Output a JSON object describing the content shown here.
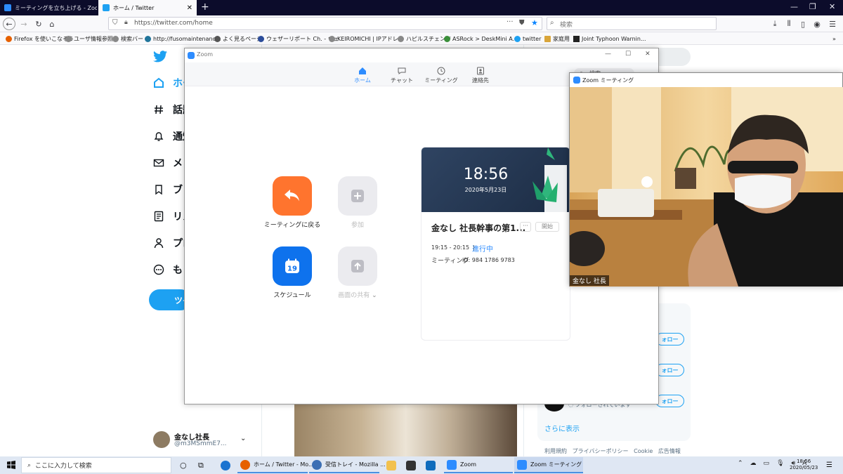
{
  "browser": {
    "tabs": [
      {
        "title": "ミーティングを立ち上げる - Zoom",
        "active": false
      },
      {
        "title": "ホーム / Twitter",
        "active": true
      }
    ],
    "url": "https://twitter.com/home",
    "search_placeholder": "検索",
    "bookmarks": [
      "Firefox を使いこなそう",
      "ユーザ情報参照",
      "検索バー",
      "http://fusomaintenanc...",
      "よく見るページ",
      "ウェザーリポート Ch. - ウェ...",
      "KEIROMICHI | IPアドレ...",
      "ハピルスチェンジ",
      "ASRock > DeskMini A...",
      "twitter",
      "家庭用",
      "Joint Typhoon Warnin..."
    ]
  },
  "twitter": {
    "nav": [
      "ホー",
      "話題",
      "通知",
      "メッ",
      "ブッ",
      "リス",
      "プロ",
      "もっ"
    ],
    "tweet_button": "ツイ",
    "profile": {
      "name": "金なし社長",
      "handle": "@m3MSmmE7..."
    },
    "follow_label": "ォロー",
    "followed_text": "フォローされています",
    "show_more": "さらに表示",
    "footer": [
      "利用規約",
      "プライバシーポリシー",
      "Cookie",
      "広告情報"
    ]
  },
  "zoom": {
    "window_title": "Zoom",
    "tabs": [
      "ホーム",
      "チャット",
      "ミーティング",
      "連絡先"
    ],
    "search_placeholder": "検索",
    "actions": [
      {
        "label": "ミーティングに戻る",
        "color": "#ff742e",
        "enabled": true
      },
      {
        "label": "参加",
        "color": "#ebebef",
        "enabled": false
      },
      {
        "label": "スケジュール",
        "color": "#0e72ed",
        "enabled": true,
        "badge": "19"
      },
      {
        "label": "画面の共有",
        "color": "#ebebef",
        "enabled": false
      }
    ],
    "share_caret": "⌄",
    "card": {
      "time": "18:56",
      "date": "2020年5月23日",
      "meeting_title": "金なし 社長幹事の第1...",
      "more": "···",
      "start_label": "開始",
      "time_range": "19:15 - 20:15",
      "separator": "|",
      "status": "進行中",
      "meeting_label": "ミーティング",
      "meeting_id": "ID: 984 1786 9783"
    }
  },
  "meeting_window": {
    "title": "Zoom ミーティング",
    "participant_name": "金なし 社長"
  },
  "taskbar": {
    "search_placeholder": "ここに入力して検索",
    "apps": [
      {
        "label": "ホーム / Twitter - Mo...",
        "color": "#e66000"
      },
      {
        "label": "受信トレイ - Mozilla ...",
        "color": "#3c6fb4"
      },
      {
        "label": "Zoom",
        "color": "#2d8cff"
      },
      {
        "label": "Zoom ミーティング",
        "color": "#2d8cff"
      }
    ],
    "tray_label": "A",
    "clock_time": "18:56",
    "clock_date": "2020/05/23"
  }
}
